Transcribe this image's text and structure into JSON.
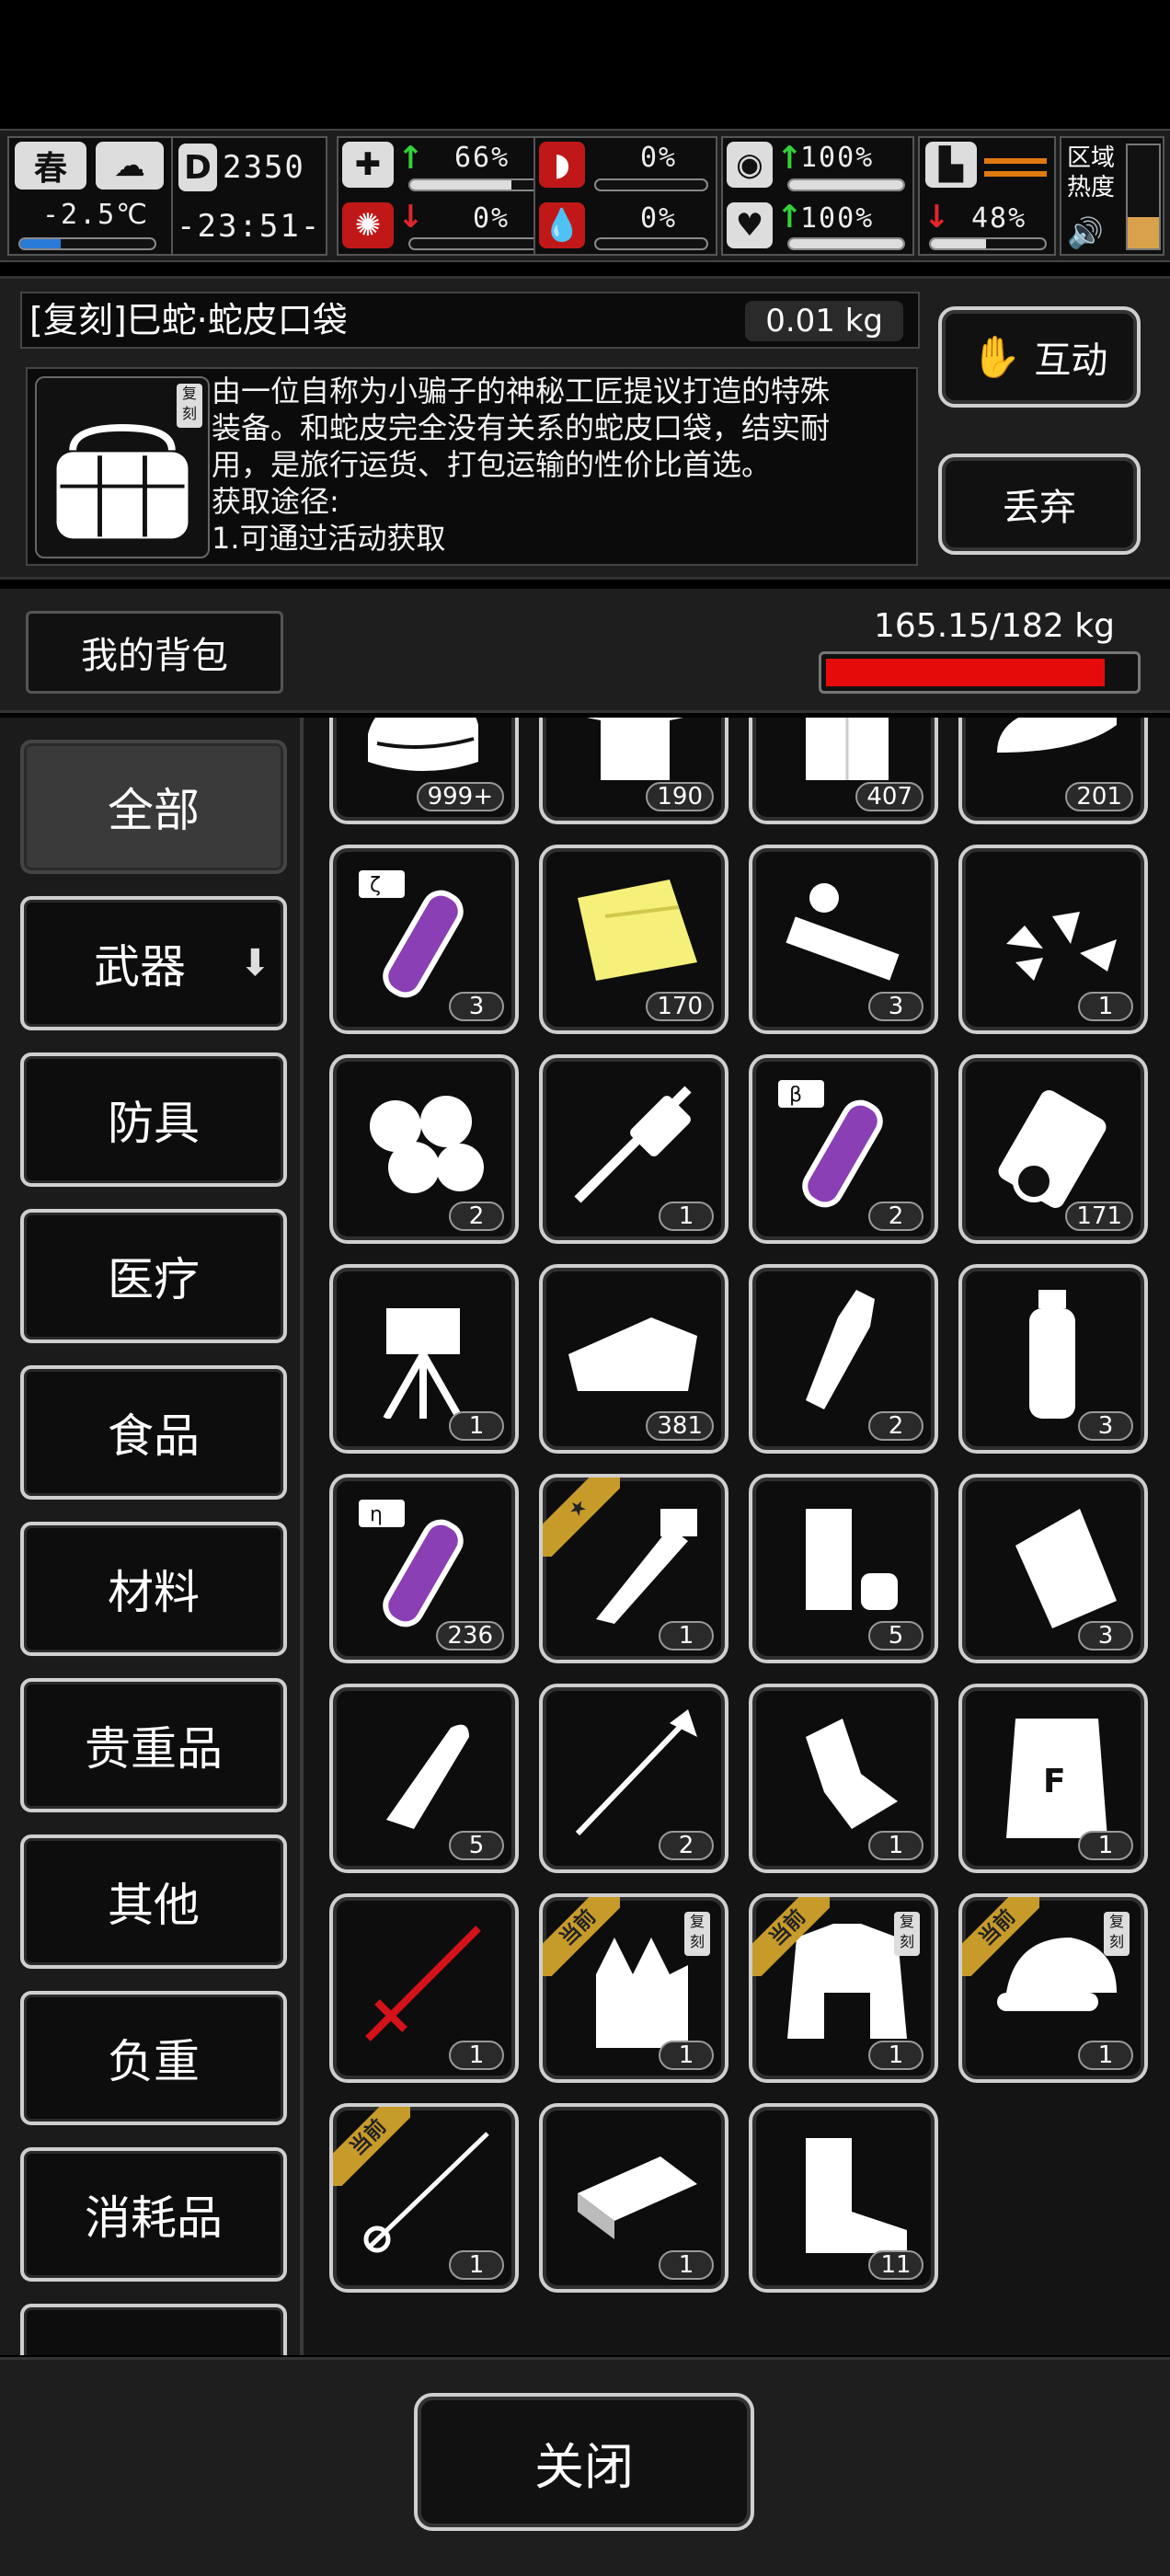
{
  "hud": {
    "season": "春",
    "temperature": "-2.5℃",
    "day_label": "D",
    "day": "2350",
    "clock": "-23:51-",
    "health_pct": "66%",
    "hunger_pct": "0%",
    "stamina_pct": "100%",
    "blood_pct": "0%",
    "water_pct": "0%",
    "mood_pct": "100%",
    "leg_pct": "48%",
    "zone_label_1": "区域",
    "zone_label_2": "热度",
    "health_fill": 0.66,
    "hunger_fill": 0,
    "stamina_fill": 1.0,
    "blood_fill": 0,
    "water_fill": 0,
    "mood_fill": 1.0,
    "leg_fill": 0.48
  },
  "detail": {
    "name": "[复刻]巳蛇·蛇皮口袋",
    "weight": "0.01 kg",
    "tag": "复刻",
    "description_lines": [
      "由一位自称为小骗子的神秘工匠提议打造的特殊",
      "装备。和蛇皮完全没有关系的蛇皮口袋，结实耐",
      "用，是旅行运货、打包运输的性价比首选。",
      "获取途径:",
      "1.可通过活动获取"
    ],
    "interact_label": "互动",
    "discard_label": "丢弃"
  },
  "bag": {
    "title": "我的背包",
    "weight": "165.15/182 kg",
    "fill": 0.907
  },
  "categories": [
    "全部",
    "武器",
    "防具",
    "医疗",
    "食品",
    "材料",
    "贵重品",
    "其他",
    "负重",
    "消耗品"
  ],
  "items": [
    {
      "icon": "cloth-pile-icon",
      "qty": "999+"
    },
    {
      "icon": "torn-shirt-icon",
      "qty": "190"
    },
    {
      "icon": "white-cloth-icon",
      "qty": "407"
    },
    {
      "icon": "folded-towel-icon",
      "qty": "201"
    },
    {
      "icon": "zeta-tube-icon",
      "qty": "3"
    },
    {
      "icon": "yellow-cloth-icon",
      "qty": "170"
    },
    {
      "icon": "broken-parts-icon",
      "qty": "3"
    },
    {
      "icon": "rubble-icon",
      "qty": "1"
    },
    {
      "icon": "cotton-icon",
      "qty": "2"
    },
    {
      "icon": "tool-icon",
      "qty": "1"
    },
    {
      "icon": "beta-tube-icon",
      "qty": "2"
    },
    {
      "icon": "bandage-roll-icon",
      "qty": "171"
    },
    {
      "icon": "turret-icon",
      "qty": "1"
    },
    {
      "icon": "cloth-sheet-icon",
      "qty": "381"
    },
    {
      "icon": "glass-bottle-icon",
      "qty": "2"
    },
    {
      "icon": "water-bottle-icon",
      "qty": "3"
    },
    {
      "icon": "eta-tube-icon",
      "qty": "236"
    },
    {
      "icon": "machete-icon",
      "qty": "1",
      "star": true
    },
    {
      "icon": "cup-icon",
      "qty": "5"
    },
    {
      "icon": "bag-icon",
      "qty": "3"
    },
    {
      "icon": "bullet-icon",
      "qty": "5"
    },
    {
      "icon": "arrow-icon",
      "qty": "2"
    },
    {
      "icon": "crushed-bottle-icon",
      "qty": "1"
    },
    {
      "icon": "flour-sack-icon",
      "qty": "1"
    },
    {
      "icon": "red-sword-icon",
      "qty": "1"
    },
    {
      "icon": "gloves-icon",
      "qty": "1",
      "ribbon": "当前",
      "tag": "复刻"
    },
    {
      "icon": "jacket-icon",
      "qty": "1",
      "ribbon": "当前",
      "tag": "复刻"
    },
    {
      "icon": "cap-icon",
      "qty": "1",
      "ribbon": "当前",
      "tag": "复刻"
    },
    {
      "icon": "thin-sword-icon",
      "qty": "1",
      "ribbon": "当前"
    },
    {
      "icon": "brick-icon",
      "qty": "1"
    },
    {
      "icon": "boot-icon",
      "qty": "11"
    }
  ],
  "footer": {
    "close_label": "关闭"
  }
}
